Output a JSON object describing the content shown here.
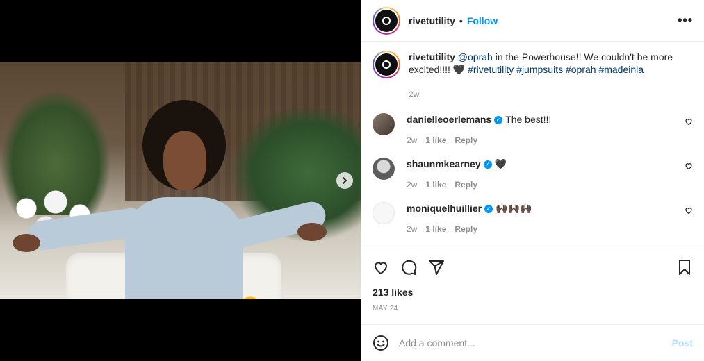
{
  "post": {
    "username": "rivetutility",
    "follow_label": "Follow",
    "separator": "•",
    "more_label": "•••"
  },
  "caption": {
    "username": "rivetutility",
    "mention": "@oprah",
    "text_part1": " in the Powerhouse!! We couldn't be more excited!!!! 🖤 ",
    "hashtags": "#rivetutility #jumpsuits #oprah #madeinla",
    "time": "2w"
  },
  "comments": [
    {
      "username": "danielleoerlemans",
      "verified": true,
      "text": "The best!!!",
      "time": "2w",
      "likes": "1 like",
      "reply": "Reply",
      "avatar_color": "#6b5e54"
    },
    {
      "username": "shaunmkearney",
      "verified": true,
      "text": "🖤",
      "time": "2w",
      "likes": "1 like",
      "reply": "Reply",
      "avatar_color": "#7c7c7c"
    },
    {
      "username": "moniquelhuillier",
      "verified": true,
      "text": "🙌🏿🙌🏿🙌🏿",
      "time": "2w",
      "likes": "1 like",
      "reply": "Reply",
      "avatar_color": "#f7f7f7"
    }
  ],
  "engagement": {
    "likes": "213 likes",
    "date": "MAY 24"
  },
  "composer": {
    "placeholder": "Add a comment...",
    "post_label": "Post"
  },
  "carousel": {
    "slide_count": 5,
    "active_index": 0
  }
}
